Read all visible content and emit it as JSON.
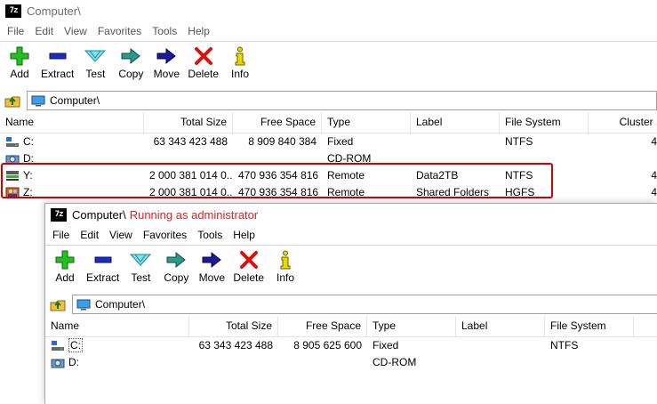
{
  "win1": {
    "app_icon_text": "7z",
    "title": "Computer\\",
    "menu": [
      "File",
      "Edit",
      "View",
      "Favorites",
      "Tools",
      "Help"
    ],
    "toolbar": [
      {
        "label": "Add",
        "icon": "add-icon"
      },
      {
        "label": "Extract",
        "icon": "extract-icon"
      },
      {
        "label": "Test",
        "icon": "test-icon"
      },
      {
        "label": "Copy",
        "icon": "copy-icon"
      },
      {
        "label": "Move",
        "icon": "move-icon"
      },
      {
        "label": "Delete",
        "icon": "delete-icon"
      },
      {
        "label": "Info",
        "icon": "info-icon"
      }
    ],
    "address": "Computer\\",
    "columns": [
      "Name",
      "Total Size",
      "Free Space",
      "Type",
      "Label",
      "File System",
      "Cluster S"
    ],
    "rows": [
      {
        "name": "C:",
        "total": "63 343 423 488",
        "free": "8 909 840 384",
        "type": "Fixed",
        "label": "",
        "fs": "NTFS",
        "cluster": "4"
      },
      {
        "name": "D:",
        "total": "",
        "free": "",
        "type": "CD-ROM",
        "label": "",
        "fs": "",
        "cluster": ""
      },
      {
        "name": "Y:",
        "total": "2 000 381 014 0...",
        "free": "470 936 354 816",
        "type": "Remote",
        "label": "Data2TB",
        "fs": "NTFS",
        "cluster": "4"
      },
      {
        "name": "Z:",
        "total": "2 000 381 014 0...",
        "free": "470 936 354 816",
        "type": "Remote",
        "label": "Shared Folders",
        "fs": "HGFS",
        "cluster": "4"
      }
    ]
  },
  "win2": {
    "app_icon_text": "7z",
    "title": "Computer\\",
    "title_suffix": "Running as administrator",
    "menu": [
      "File",
      "Edit",
      "View",
      "Favorites",
      "Tools",
      "Help"
    ],
    "toolbar": [
      {
        "label": "Add",
        "icon": "add-icon"
      },
      {
        "label": "Extract",
        "icon": "extract-icon"
      },
      {
        "label": "Test",
        "icon": "test-icon"
      },
      {
        "label": "Copy",
        "icon": "copy-icon"
      },
      {
        "label": "Move",
        "icon": "move-icon"
      },
      {
        "label": "Delete",
        "icon": "delete-icon"
      },
      {
        "label": "Info",
        "icon": "info-icon"
      }
    ],
    "address": "Computer\\",
    "columns": [
      "Name",
      "Total Size",
      "Free Space",
      "Type",
      "Label",
      "File System"
    ],
    "rows": [
      {
        "name": "C:",
        "total": "63 343 423 488",
        "free": "8 905 625 600",
        "type": "Fixed",
        "label": "",
        "fs": "NTFS"
      },
      {
        "name": "D:",
        "total": "",
        "free": "",
        "type": "CD-ROM",
        "label": "",
        "fs": ""
      }
    ]
  },
  "colors": {
    "highlight_box": "#d40000",
    "admin_text": "#e02020"
  }
}
